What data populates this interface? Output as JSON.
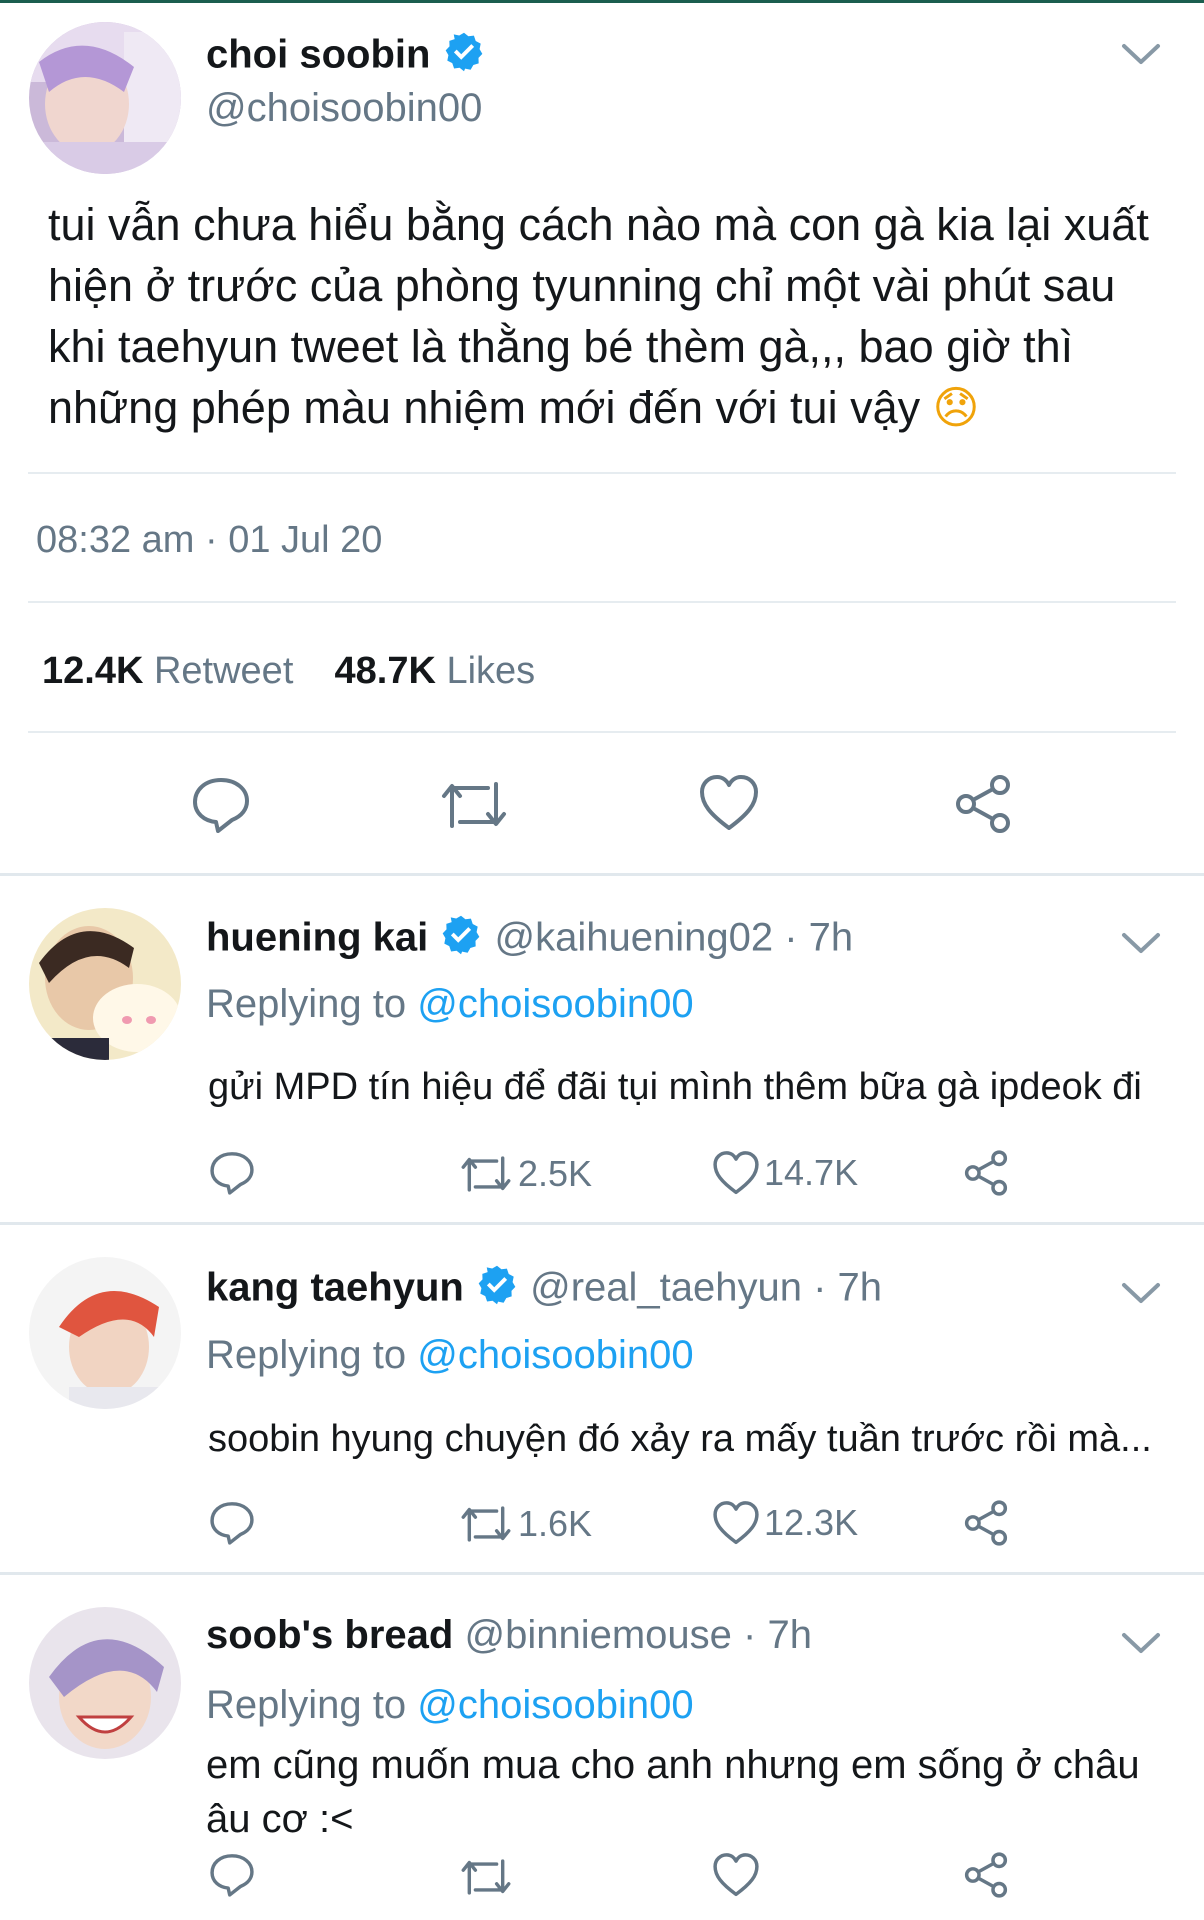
{
  "tweet": {
    "display_name": "choi soobin",
    "handle": "@choisoobin00",
    "text": "tui vẫn chưa hiểu bằng cách nào mà con gà kia lại xuất hiện ở trước của phòng tyunning chỉ một vài phút sau khi taehyun tweet là thằng bé thèm gà,,, bao giờ thì những phép màu nhiệm mới đến với tui vậy",
    "emoji": "😞",
    "timestamp": "08:32 am · 01 Jul 20",
    "retweet_count": "12.4K",
    "retweet_label": "Retweet",
    "likes_count": "48.7K",
    "likes_label": "Likes"
  },
  "replies": [
    {
      "display_name": "huening kai",
      "handle": "@kaihuening02",
      "time": "· 7h",
      "replying_label": "Replying to",
      "replying_handle": "@choisoobin00",
      "text": "gửi MPD tín hiệu để đãi tụi mình thêm bữa gà ipdeok đi",
      "retweets": "2.5K",
      "likes": "14.7K"
    },
    {
      "display_name": "kang taehyun",
      "handle": "@real_taehyun",
      "time": "· 7h",
      "replying_label": "Replying to",
      "replying_handle": "@choisoobin00",
      "text": "soobin hyung chuyện đó xảy ra mấy tuần trước rồi mà...",
      "retweets": "1.6K",
      "likes": "12.3K"
    },
    {
      "display_name": "soob's bread",
      "handle": "@binniemouse",
      "time": "· 7h",
      "replying_label": "Replying to",
      "replying_handle": "@choisoobin00",
      "text_line1": "em cũng muốn mua cho anh nhưng em sống ở châu",
      "text_line2": "âu cơ :<"
    }
  ],
  "colors": {
    "accent": "#1da1f2",
    "gray_text": "#657786",
    "divider": "#e6ecf0"
  },
  "icons": [
    "verified-badge-icon",
    "chevron-down-icon",
    "reply-icon",
    "retweet-icon",
    "like-icon",
    "share-icon"
  ]
}
